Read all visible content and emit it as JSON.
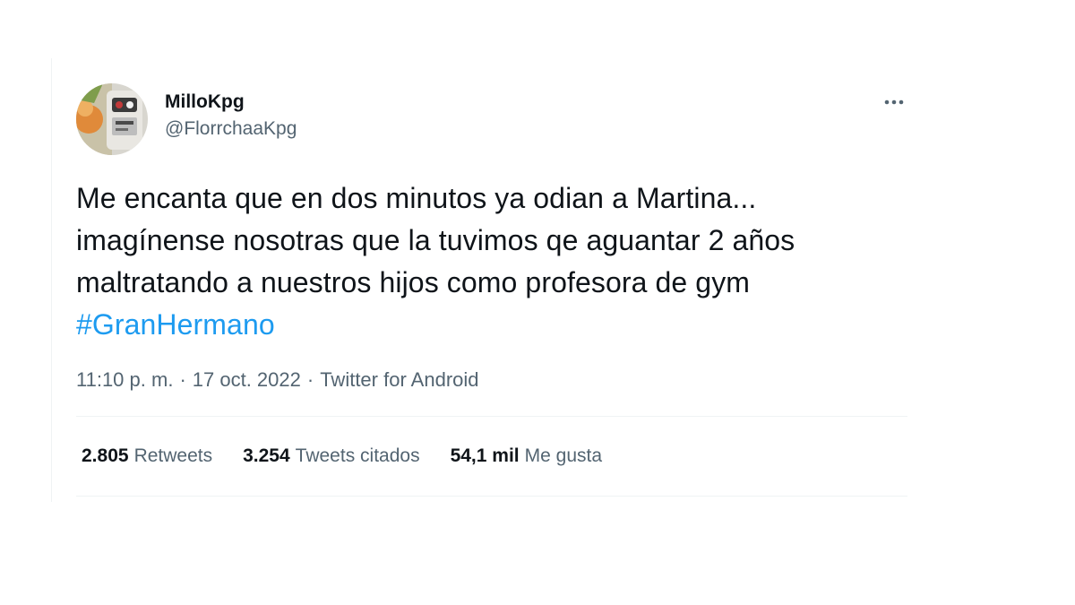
{
  "tweet": {
    "author": {
      "display_name": "MilloKpg",
      "handle": "@FlorrchaaKpg"
    },
    "text_before_hashtag": "Me encanta que en dos minutos ya odian a Martina... imagínense nosotras que la tuvimos qe aguantar 2 años maltratando a nuestros hijos como profesora de gym ",
    "hashtag": "#GranHermano",
    "time": "11:10 p. m.",
    "separator": "·",
    "date": "17 oct. 2022",
    "source": "Twitter for Android",
    "stats": {
      "retweets_count": "2.805",
      "retweets_label": "Retweets",
      "quotes_count": "3.254",
      "quotes_label": "Tweets citados",
      "likes_count": "54,1 mil",
      "likes_label": "Me gusta"
    },
    "more_icon": "more-horizontal-icon"
  },
  "colors": {
    "text": "#0f1419",
    "secondary": "#536471",
    "accent": "#1d9bf0",
    "border": "#eff3f4"
  }
}
